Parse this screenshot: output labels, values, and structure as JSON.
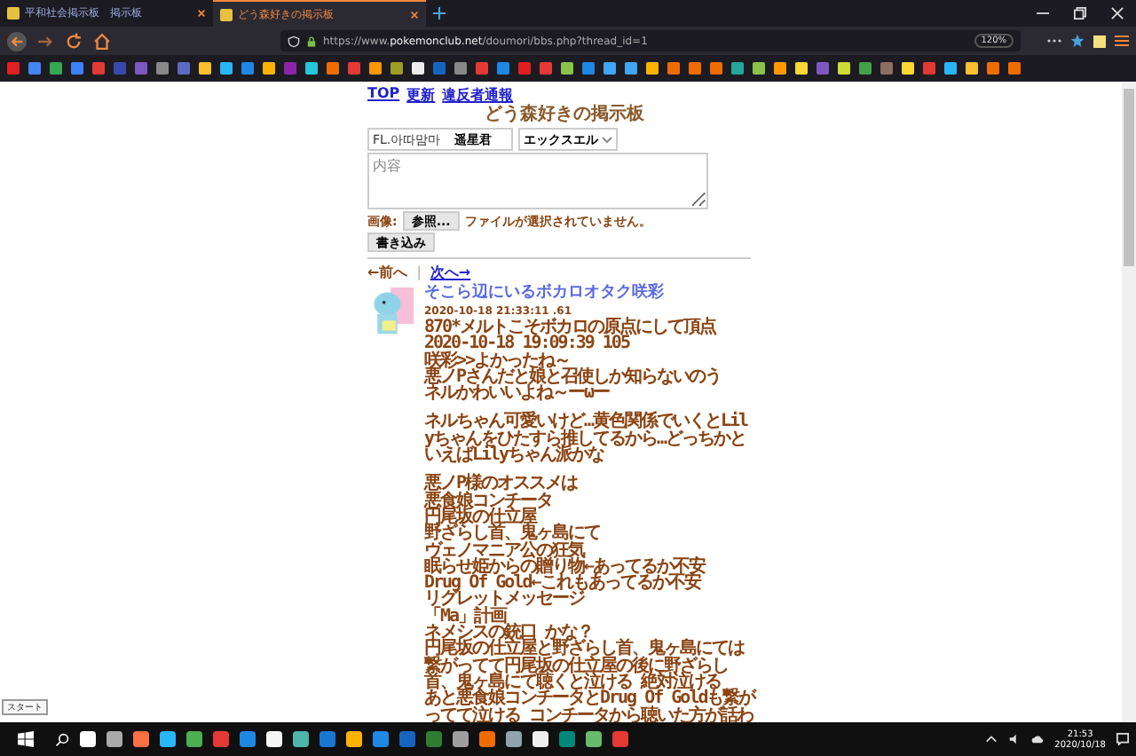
{
  "browser": {
    "tabs": [
      {
        "label": "平和社会掲示板　掲示板",
        "selected": false
      },
      {
        "label": "どう森好きの掲示板",
        "selected": true
      }
    ],
    "url_prefix": "https://www.",
    "url_domain": "pokemonclub.net",
    "url_path": "/doumori/bbs.php?thread_id=1",
    "zoom": "120%"
  },
  "page": {
    "top_links": [
      "TOP",
      "更新",
      "違反者通報"
    ],
    "title": "どう森好きの掲示板",
    "form": {
      "name_value": "FL.아따맘마",
      "trip_value": "遥星君",
      "select_value": "エックスエル",
      "content_placeholder": "内容",
      "image_label": "画像:",
      "browse_button": "参照...",
      "file_status": "ファイルが選択されていません。",
      "submit_button": "書き込み"
    },
    "nav": {
      "prev": "←前へ",
      "separator": "|",
      "next": "次へ→"
    },
    "post": {
      "author": "そこら辺にいるボカロオタク咲彩",
      "timestamp": "2020-10-18 21:33:11 .61",
      "paragraphs": [
        [
          "870*メルトこそボカロの原点にして頂点",
          "2020-10-18 19:09:39 105",
          "咲彩>>よかったね～",
          "悪ノPさんだと娘と召使しか知らないのう",
          "ネルかわいいよね～ーωー"
        ],
        [
          "ネルちゃん可愛いけど…黄色関係でいくとLil",
          "yちゃんをひたすら推してるから…どっちかと",
          "いえばLilyちゃん派かな"
        ],
        [
          "悪ノP様のオススメは",
          "悪食娘コンチータ",
          "円尾坂の仕立屋",
          "野ざらし首、鬼ヶ島にて",
          "ヴェノマニア公の狂気",
          "眠らせ姫からの贈り物←あってるか不安",
          "Drug Of Gold←これもあってるか不安",
          "リグレットメッセージ",
          "「Ma」計画",
          "ネメシスの銃口 かな？",
          "円尾坂の仕立屋と野ざらし首、鬼ヶ島にては",
          "繋がってて円尾坂の仕立屋の後に野ざらし",
          "首、鬼ヶ島にて聴くと泣ける 絶対泣ける",
          "あと悪食娘コンチータとDrug Of Goldも繋が",
          "ってて泣ける コンチータから聴いた方が話わ"
        ]
      ]
    }
  },
  "tooltip": "スタート",
  "taskbar": {
    "time": "21:53",
    "date": "2020/10/18"
  }
}
